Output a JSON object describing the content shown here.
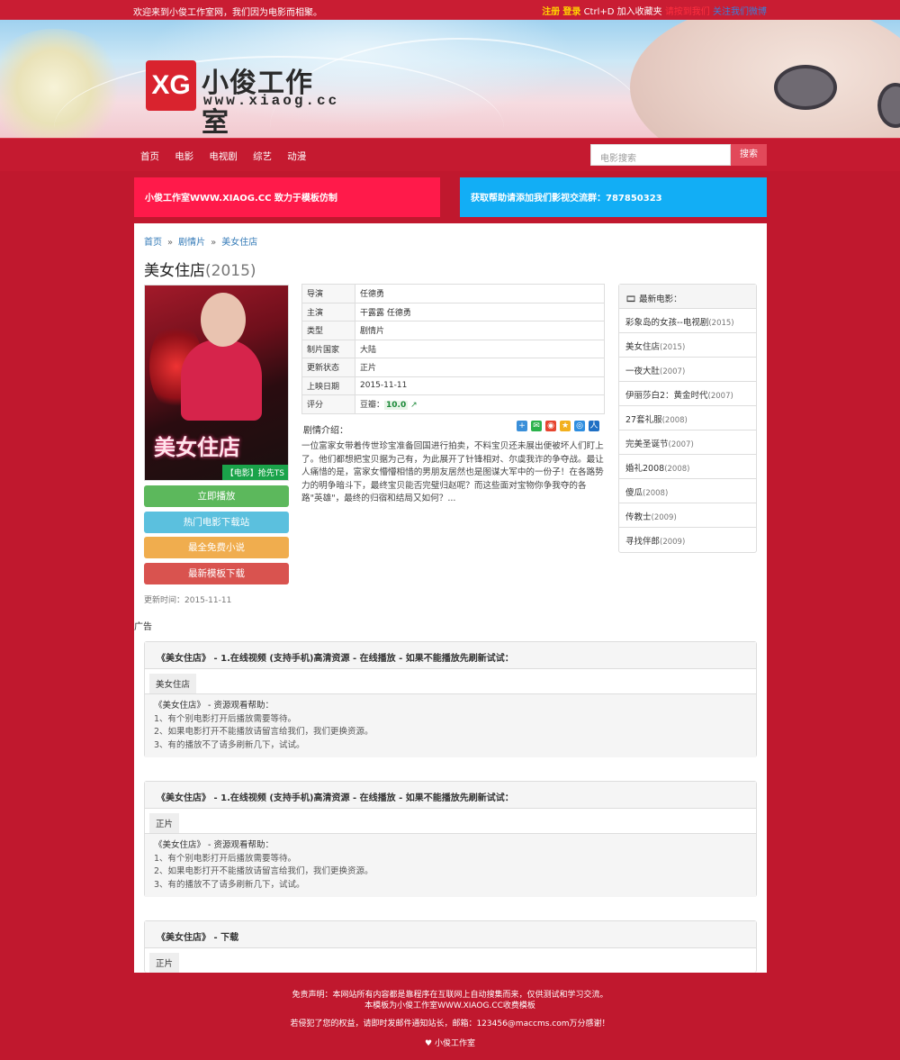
{
  "topbar": {
    "welcome": "欢迎来到小俊工作室网，我们因为电影而相聚。",
    "register": "注册",
    "login": "登录",
    "favorite": "Ctrl+D 加入收藏夹",
    "link_red": "请按到我们",
    "link_blue": "关注我们微博"
  },
  "logo": {
    "mark": "XG",
    "cn": "小俊工作室",
    "en": "www.xiaog.cc"
  },
  "nav": {
    "items": [
      "首页",
      "电影",
      "电视剧",
      "综艺",
      "动漫"
    ],
    "search_placeholder": "电影搜索",
    "search_button": "搜索"
  },
  "notices": {
    "left": "小俊工作室WWW.XIAOG.CC 致力于模板仿制",
    "right": "获取帮助请添加我们影视交流群：787850323"
  },
  "breadcrumb": {
    "home": "首页",
    "sep": "»",
    "category": "剧情片",
    "current": "美女住店"
  },
  "movie": {
    "title": "美女住店",
    "year": "(2015)",
    "poster_title": "美女住店",
    "poster_tag": "【电影】抢先TS",
    "info": [
      {
        "k": "导演",
        "v": "任德勇"
      },
      {
        "k": "主演",
        "v": "干露露 任德勇"
      },
      {
        "k": "类型",
        "v": "剧情片"
      },
      {
        "k": "制片国家",
        "v": "大陆"
      },
      {
        "k": "更新状态",
        "v": "正片"
      },
      {
        "k": "上映日期",
        "v": "2015-11-11"
      }
    ],
    "rating_key": "评分",
    "rating_label": "豆瓣：",
    "rating_value": "10.0",
    "intro_label": "剧情介绍：",
    "intro": "一位富家女带着传世珍宝准备回国进行拍卖，不料宝贝还未展出便被坏人们盯上了。他们都想把宝贝据为己有，为此展开了针锋相对、尔虞我诈的争夺战。最让人痛惜的是，富家女懵懵相惜的男朋友居然也是图谋大军中的一份子！在各路势力的明争暗斗下，最终宝贝能否完璧归赵呢？而这些面对宝物你争我夺的各路\"英雄\"，最终的归宿和结局又如何？...",
    "updated": "更新时间：2015-11-11"
  },
  "buttons": {
    "play": "立即播放",
    "hot": "热门电影下载站",
    "novel": "最全免费小说",
    "template": "最新模板下载"
  },
  "sidebar": {
    "header": "最新电影：",
    "items": [
      {
        "name": "彩象岛的女孩--电视剧",
        "year": "(2015)"
      },
      {
        "name": "美女住店",
        "year": "(2015)"
      },
      {
        "name": "一夜大肚",
        "year": "(2007)"
      },
      {
        "name": "伊丽莎白2：黄金时代",
        "year": "(2007)"
      },
      {
        "name": "27套礼服",
        "year": "(2008)"
      },
      {
        "name": "完美圣诞节",
        "year": "(2007)"
      },
      {
        "name": "婚礼2008",
        "year": "(2008)"
      },
      {
        "name": "傻瓜",
        "year": "(2008)"
      },
      {
        "name": "传教士",
        "year": "(2009)"
      },
      {
        "name": "寻找伴郎",
        "year": "(2009)"
      }
    ]
  },
  "ad_label": "广告",
  "panels": [
    {
      "header": "《美女住店》 - 1.在线视频 (支持手机)高清资源 - 在线播放 - 如果不能播放先刷新试试：",
      "chip": "美女住店",
      "help_title": "《美女住店》 - 资源观看帮助：",
      "help": [
        "1、有个别电影打开后播放需要等待。",
        "2、如果电影打开不能播放请留言给我们，我们更换资源。",
        "3、有的播放不了请多刷新几下，试试。"
      ]
    },
    {
      "header": "《美女住店》 - 1.在线视频 (支持手机)高清资源 - 在线播放 - 如果不能播放先刷新试试：",
      "chip": "正片",
      "help_title": "《美女住店》 - 资源观看帮助：",
      "help": [
        "1、有个别电影打开后播放需要等待。",
        "2、如果电影打开不能播放请留言给我们，我们更换资源。",
        "3、有的播放不了请多刷新几下，试试。"
      ]
    },
    {
      "header": "《美女住店》 - 下载",
      "chip": "正片"
    }
  ],
  "footer": {
    "line1": "免责声明：本网站所有内容都是靠程序在互联网上自动搜集而来，仅供测试和学习交流。",
    "line2": "本模板为小俊工作室WWW.XIAOG.CC收费模板",
    "line3": "若侵犯了您的权益，请即时发邮件通知站长，邮箱：123456@maccms.com万分感谢！",
    "line4": "♥ 小俊工作室"
  },
  "colors": {
    "page_bg": "#c0182e",
    "notice_left": "#ff1a4a",
    "notice_right": "#12aef5",
    "btn_play": "#5cb85c",
    "btn_hot": "#5bc0de",
    "btn_novel": "#f0ad4e",
    "btn_template": "#d9534f"
  }
}
